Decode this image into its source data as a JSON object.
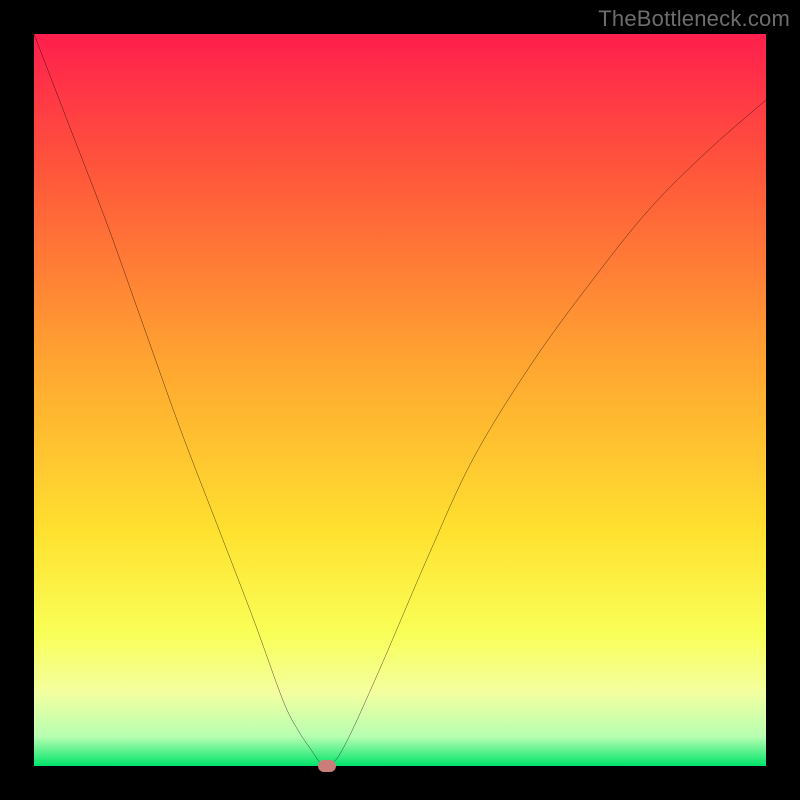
{
  "watermark": "TheBottleneck.com",
  "colors": {
    "frame": "#000000",
    "gradient_stops": [
      {
        "offset": 0.0,
        "color": "#ff1f4d"
      },
      {
        "offset": 0.2,
        "color": "#ff5a3a"
      },
      {
        "offset": 0.45,
        "color": "#ffa531"
      },
      {
        "offset": 0.68,
        "color": "#ffe12f"
      },
      {
        "offset": 0.82,
        "color": "#f9ff58"
      },
      {
        "offset": 0.9,
        "color": "#f3ffa0"
      },
      {
        "offset": 0.96,
        "color": "#b6ffb1"
      },
      {
        "offset": 1.0,
        "color": "#00e36a"
      }
    ],
    "curve": "#000000",
    "marker": "#cb7d79"
  },
  "chart_data": {
    "type": "line",
    "title": "",
    "xlabel": "",
    "ylabel": "",
    "xlim": [
      0,
      100
    ],
    "ylim": [
      0,
      100
    ],
    "marker": {
      "x": 40,
      "y": 0
    },
    "series": [
      {
        "name": "curve",
        "x": [
          0,
          5,
          10,
          15,
          20,
          25,
          30,
          34,
          36,
          38,
          39,
          40,
          41,
          42,
          44,
          48,
          54,
          60,
          68,
          76,
          84,
          92,
          100
        ],
        "y": [
          100,
          87,
          74,
          60,
          46,
          33,
          20,
          9,
          5,
          2,
          0.6,
          0,
          0.6,
          2,
          6,
          15,
          29,
          42,
          55,
          66,
          76,
          84,
          91
        ]
      }
    ]
  }
}
